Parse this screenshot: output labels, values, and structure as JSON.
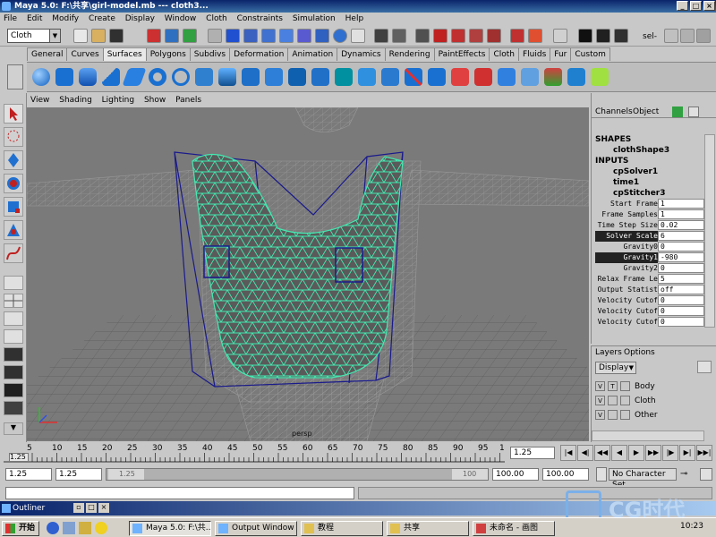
{
  "window": {
    "title": "Maya 5.0: F:\\共享\\girl-model.mb  ---  cloth3..."
  },
  "menus": [
    "File",
    "Edit",
    "Modify",
    "Create",
    "Display",
    "Window",
    "Cloth",
    "Constraints",
    "Simulation",
    "Help"
  ],
  "status_line": {
    "mode": "Cloth",
    "sel_label": "sel-"
  },
  "shelf_tabs": [
    {
      "label": "General"
    },
    {
      "label": "Curves"
    },
    {
      "label": "Surfaces",
      "active": true
    },
    {
      "label": "Polygons"
    },
    {
      "label": "Subdivs"
    },
    {
      "label": "Deformation"
    },
    {
      "label": "Animation"
    },
    {
      "label": "Dynamics"
    },
    {
      "label": "Rendering"
    },
    {
      "label": "PaintEffects"
    },
    {
      "label": "Cloth"
    },
    {
      "label": "Fluids"
    },
    {
      "label": "Fur"
    },
    {
      "label": "Custom"
    }
  ],
  "viewport_menu": [
    "View",
    "Shading",
    "Lighting",
    "Show",
    "Panels"
  ],
  "viewport_label": "persp",
  "channel_box": {
    "tabs": [
      "Channels",
      "Object"
    ],
    "shapes_header": "SHAPES",
    "shape": "clothShape3",
    "inputs_header": "INPUTS",
    "inputs": [
      "cpSolver1",
      "time1",
      "cpStitcher3"
    ],
    "attributes": [
      {
        "label": "Start Frame",
        "value": "1"
      },
      {
        "label": "Frame Samples",
        "value": "1"
      },
      {
        "label": "Time Step Size",
        "value": "0.02"
      },
      {
        "label": "Solver Scale",
        "value": "6",
        "highlight": true
      },
      {
        "label": "Gravity0",
        "value": "0"
      },
      {
        "label": "Gravity1",
        "value": "-980",
        "highlight": true
      },
      {
        "label": "Gravity2",
        "value": "0"
      },
      {
        "label": "Relax Frame Le",
        "value": "5"
      },
      {
        "label": "Output Statist",
        "value": "off"
      },
      {
        "label": "Velocity Cutof",
        "value": "0"
      },
      {
        "label": "Velocity Cutof",
        "value": "0"
      },
      {
        "label": "Velocity Cutof",
        "value": "0"
      }
    ]
  },
  "layers": {
    "tabs": [
      "Layers",
      "Options"
    ],
    "display": "Display",
    "items": [
      {
        "v": "V",
        "t": "T",
        "name": "Body"
      },
      {
        "v": "V",
        "t": "",
        "name": "Cloth"
      },
      {
        "v": "V",
        "t": "",
        "name": "Other"
      }
    ]
  },
  "time_slider": {
    "ticks": [
      "5",
      "10",
      "15",
      "20",
      "25",
      "30",
      "35",
      "40",
      "45",
      "50",
      "55",
      "60",
      "65",
      "70",
      "75",
      "80",
      "85",
      "90",
      "95",
      "1"
    ],
    "current_left": "1.25",
    "current_field": "1.25"
  },
  "range_slider": {
    "start": "1.25",
    "start2": "1.25",
    "inner_start": "1.25",
    "inner_end": "100",
    "end": "100.00",
    "end2": "100.00",
    "character_set": "No Character Set"
  },
  "outliner": {
    "title": "Outliner"
  },
  "taskbar": {
    "start": "开始",
    "buttons": [
      {
        "label": "Maya 5.0: F:\\共...",
        "pressed": true
      },
      {
        "label": "Output Window",
        "pressed": false
      },
      {
        "label": "教程",
        "pressed": false
      },
      {
        "label": "共享",
        "pressed": false
      },
      {
        "label": "未命名 - 画图",
        "pressed": false
      }
    ],
    "clock": "10:23"
  },
  "watermark": {
    "text": "CG时代"
  },
  "colors": {
    "accent": "#0a246a",
    "cloth": "#44e8b0",
    "cage": "#1a1a8c"
  }
}
